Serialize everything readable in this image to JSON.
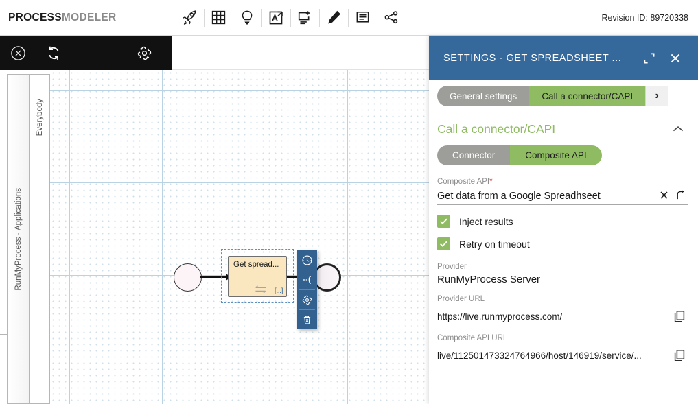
{
  "app": {
    "brand_bold": "PROCESS",
    "brand_light": "MODELER",
    "revision": "Revision ID: 89720338"
  },
  "toolbar": {
    "icons": [
      {
        "name": "rocket-icon",
        "label": "Publish"
      },
      {
        "name": "grid-icon",
        "label": "Grid"
      },
      {
        "name": "lightbulb-icon",
        "label": "Hints"
      },
      {
        "name": "pdf-export-icon",
        "label": "Export PDF"
      },
      {
        "name": "add-panel-icon",
        "label": "Add"
      },
      {
        "name": "pen-icon",
        "label": "Draw"
      },
      {
        "name": "document-icon",
        "label": "Documentation"
      },
      {
        "name": "share-icon",
        "label": "Share"
      }
    ]
  },
  "blackbar": {
    "close_label": "Close",
    "refresh_label": "Refresh",
    "gear_label": "Settings"
  },
  "canvas": {
    "pool_label": "RunMyProcess - Applications",
    "lane_label": "Everybody",
    "task_label": "Get spread...",
    "task_marker": "[...]",
    "context_icons": [
      {
        "name": "clock-icon",
        "label": "Timer"
      },
      {
        "name": "branch-icon",
        "label": "Boundary event"
      },
      {
        "name": "gear-icon",
        "label": "Configure"
      },
      {
        "name": "trash-icon",
        "label": "Delete"
      }
    ]
  },
  "panel": {
    "title": "SETTINGS  -  GET SPREADSHEET ...",
    "expand_label": "Expand",
    "close_label": "Close",
    "tabs": [
      {
        "label": "General settings",
        "active": false
      },
      {
        "label": "Call a connector/CAPI",
        "active": true
      }
    ],
    "tab_next": "›",
    "section": {
      "title": "Call a connector/CAPI",
      "collapse_label": "Collapse"
    },
    "segmented": [
      {
        "label": "Connector",
        "active": false
      },
      {
        "label": "Composite API",
        "active": true
      }
    ],
    "composite_api": {
      "label": "Composite API",
      "required_marker": "*",
      "value": "Get data from a Google Spreadhseet",
      "clear_label": "Clear",
      "open_label": "Open"
    },
    "checkboxes": [
      {
        "label": "Inject results",
        "checked": true
      },
      {
        "label": "Retry on timeout",
        "checked": true
      }
    ],
    "provider": {
      "label": "Provider",
      "value": "RunMyProcess Server"
    },
    "provider_url": {
      "label": "Provider URL",
      "value": "https://live.runmyprocess.com/",
      "copy_label": "Copy"
    },
    "composite_api_url": {
      "label": "Composite API URL",
      "value": "live/112501473324764966/host/146919/service/...",
      "copy_label": "Copy"
    }
  },
  "colors": {
    "header_blue": "#35689b",
    "accent_green": "#8fbb63",
    "inactive_gray": "#9d9d99",
    "task_fill": "#fbe7bf",
    "context_blue": "#33618f"
  }
}
